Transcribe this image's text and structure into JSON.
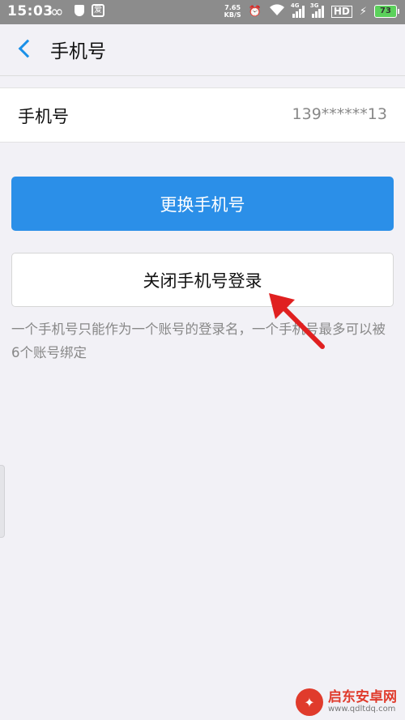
{
  "status_bar": {
    "time": "15:03",
    "app_badge": "爱",
    "speed_value": "7.65",
    "speed_unit": "KB/S",
    "net1": "4G",
    "net2": "3G",
    "hd": "HD",
    "battery": "73"
  },
  "nav": {
    "title": "手机号"
  },
  "phone_row": {
    "label": "手机号",
    "value": "139******13"
  },
  "buttons": {
    "change_phone": "更换手机号",
    "disable_phone_login": "关闭手机号登录"
  },
  "note": "一个手机号只能作为一个账号的登录名，一个手机号最多可以被6个账号绑定",
  "watermark": {
    "title": "启东安卓网",
    "url": "www.qdltdq.com"
  },
  "colors": {
    "accent": "#2b8fe8",
    "annotation_arrow": "#e02020",
    "background": "#f2f1f6"
  }
}
